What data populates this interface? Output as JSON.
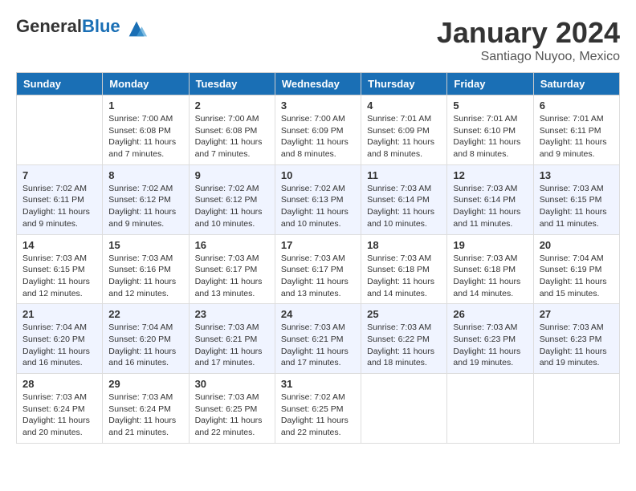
{
  "header": {
    "logo_general": "General",
    "logo_blue": "Blue",
    "month_title": "January 2024",
    "location": "Santiago Nuyoo, Mexico"
  },
  "days_of_week": [
    "Sunday",
    "Monday",
    "Tuesday",
    "Wednesday",
    "Thursday",
    "Friday",
    "Saturday"
  ],
  "weeks": [
    [
      {
        "day": "",
        "info": ""
      },
      {
        "day": "1",
        "info": "Sunrise: 7:00 AM\nSunset: 6:08 PM\nDaylight: 11 hours\nand 7 minutes."
      },
      {
        "day": "2",
        "info": "Sunrise: 7:00 AM\nSunset: 6:08 PM\nDaylight: 11 hours\nand 7 minutes."
      },
      {
        "day": "3",
        "info": "Sunrise: 7:00 AM\nSunset: 6:09 PM\nDaylight: 11 hours\nand 8 minutes."
      },
      {
        "day": "4",
        "info": "Sunrise: 7:01 AM\nSunset: 6:09 PM\nDaylight: 11 hours\nand 8 minutes."
      },
      {
        "day": "5",
        "info": "Sunrise: 7:01 AM\nSunset: 6:10 PM\nDaylight: 11 hours\nand 8 minutes."
      },
      {
        "day": "6",
        "info": "Sunrise: 7:01 AM\nSunset: 6:11 PM\nDaylight: 11 hours\nand 9 minutes."
      }
    ],
    [
      {
        "day": "7",
        "info": "Sunrise: 7:02 AM\nSunset: 6:11 PM\nDaylight: 11 hours\nand 9 minutes."
      },
      {
        "day": "8",
        "info": "Sunrise: 7:02 AM\nSunset: 6:12 PM\nDaylight: 11 hours\nand 9 minutes."
      },
      {
        "day": "9",
        "info": "Sunrise: 7:02 AM\nSunset: 6:12 PM\nDaylight: 11 hours\nand 10 minutes."
      },
      {
        "day": "10",
        "info": "Sunrise: 7:02 AM\nSunset: 6:13 PM\nDaylight: 11 hours\nand 10 minutes."
      },
      {
        "day": "11",
        "info": "Sunrise: 7:03 AM\nSunset: 6:14 PM\nDaylight: 11 hours\nand 10 minutes."
      },
      {
        "day": "12",
        "info": "Sunrise: 7:03 AM\nSunset: 6:14 PM\nDaylight: 11 hours\nand 11 minutes."
      },
      {
        "day": "13",
        "info": "Sunrise: 7:03 AM\nSunset: 6:15 PM\nDaylight: 11 hours\nand 11 minutes."
      }
    ],
    [
      {
        "day": "14",
        "info": "Sunrise: 7:03 AM\nSunset: 6:15 PM\nDaylight: 11 hours\nand 12 minutes."
      },
      {
        "day": "15",
        "info": "Sunrise: 7:03 AM\nSunset: 6:16 PM\nDaylight: 11 hours\nand 12 minutes."
      },
      {
        "day": "16",
        "info": "Sunrise: 7:03 AM\nSunset: 6:17 PM\nDaylight: 11 hours\nand 13 minutes."
      },
      {
        "day": "17",
        "info": "Sunrise: 7:03 AM\nSunset: 6:17 PM\nDaylight: 11 hours\nand 13 minutes."
      },
      {
        "day": "18",
        "info": "Sunrise: 7:03 AM\nSunset: 6:18 PM\nDaylight: 11 hours\nand 14 minutes."
      },
      {
        "day": "19",
        "info": "Sunrise: 7:03 AM\nSunset: 6:18 PM\nDaylight: 11 hours\nand 14 minutes."
      },
      {
        "day": "20",
        "info": "Sunrise: 7:04 AM\nSunset: 6:19 PM\nDaylight: 11 hours\nand 15 minutes."
      }
    ],
    [
      {
        "day": "21",
        "info": "Sunrise: 7:04 AM\nSunset: 6:20 PM\nDaylight: 11 hours\nand 16 minutes."
      },
      {
        "day": "22",
        "info": "Sunrise: 7:04 AM\nSunset: 6:20 PM\nDaylight: 11 hours\nand 16 minutes."
      },
      {
        "day": "23",
        "info": "Sunrise: 7:03 AM\nSunset: 6:21 PM\nDaylight: 11 hours\nand 17 minutes."
      },
      {
        "day": "24",
        "info": "Sunrise: 7:03 AM\nSunset: 6:21 PM\nDaylight: 11 hours\nand 17 minutes."
      },
      {
        "day": "25",
        "info": "Sunrise: 7:03 AM\nSunset: 6:22 PM\nDaylight: 11 hours\nand 18 minutes."
      },
      {
        "day": "26",
        "info": "Sunrise: 7:03 AM\nSunset: 6:23 PM\nDaylight: 11 hours\nand 19 minutes."
      },
      {
        "day": "27",
        "info": "Sunrise: 7:03 AM\nSunset: 6:23 PM\nDaylight: 11 hours\nand 19 minutes."
      }
    ],
    [
      {
        "day": "28",
        "info": "Sunrise: 7:03 AM\nSunset: 6:24 PM\nDaylight: 11 hours\nand 20 minutes."
      },
      {
        "day": "29",
        "info": "Sunrise: 7:03 AM\nSunset: 6:24 PM\nDaylight: 11 hours\nand 21 minutes."
      },
      {
        "day": "30",
        "info": "Sunrise: 7:03 AM\nSunset: 6:25 PM\nDaylight: 11 hours\nand 22 minutes."
      },
      {
        "day": "31",
        "info": "Sunrise: 7:02 AM\nSunset: 6:25 PM\nDaylight: 11 hours\nand 22 minutes."
      },
      {
        "day": "",
        "info": ""
      },
      {
        "day": "",
        "info": ""
      },
      {
        "day": "",
        "info": ""
      }
    ]
  ]
}
